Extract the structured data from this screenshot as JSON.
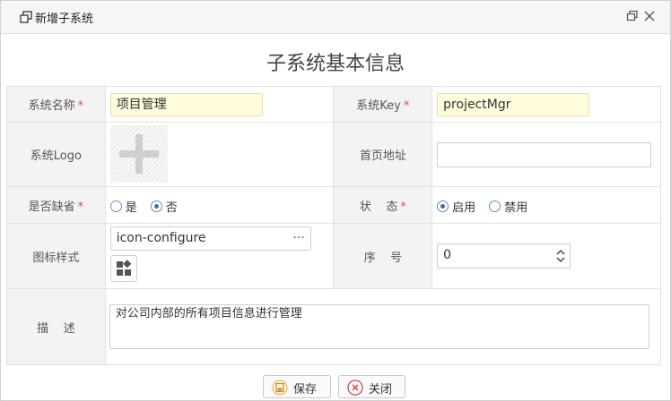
{
  "window": {
    "title": "新增子系统",
    "icons": [
      "window-icon",
      "restore-icon",
      "close-icon"
    ]
  },
  "heading": "子系统基本信息",
  "form": {
    "name": {
      "label": "系统名称",
      "required": "*",
      "value": "项目管理"
    },
    "key": {
      "label": "系统Key",
      "required": "*",
      "value": "projectMgr"
    },
    "logo": {
      "label": "系统Logo",
      "icon": "add-image-icon"
    },
    "homepage": {
      "label": "首页地址",
      "value": ""
    },
    "is_default": {
      "label": "是否缺省",
      "required": "*",
      "options": [
        "是",
        "否"
      ],
      "selected": "否"
    },
    "status": {
      "label": "状    态",
      "required": "*",
      "options": [
        "启用",
        "禁用"
      ],
      "selected": "启用"
    },
    "icon_style": {
      "label": "图标样式",
      "value": "icon-configure",
      "more": "···",
      "preview_icon": "configure-icon"
    },
    "order": {
      "label": "序    号",
      "value": "0"
    },
    "description": {
      "label": "描    述",
      "value": "对公司内部的所有项目信息进行管理"
    }
  },
  "buttons": {
    "save": "保存",
    "close": "关闭"
  },
  "colors": {
    "accent": "#3f6fb0",
    "required": "#e24b4b",
    "highlight": "#fffbdd"
  }
}
